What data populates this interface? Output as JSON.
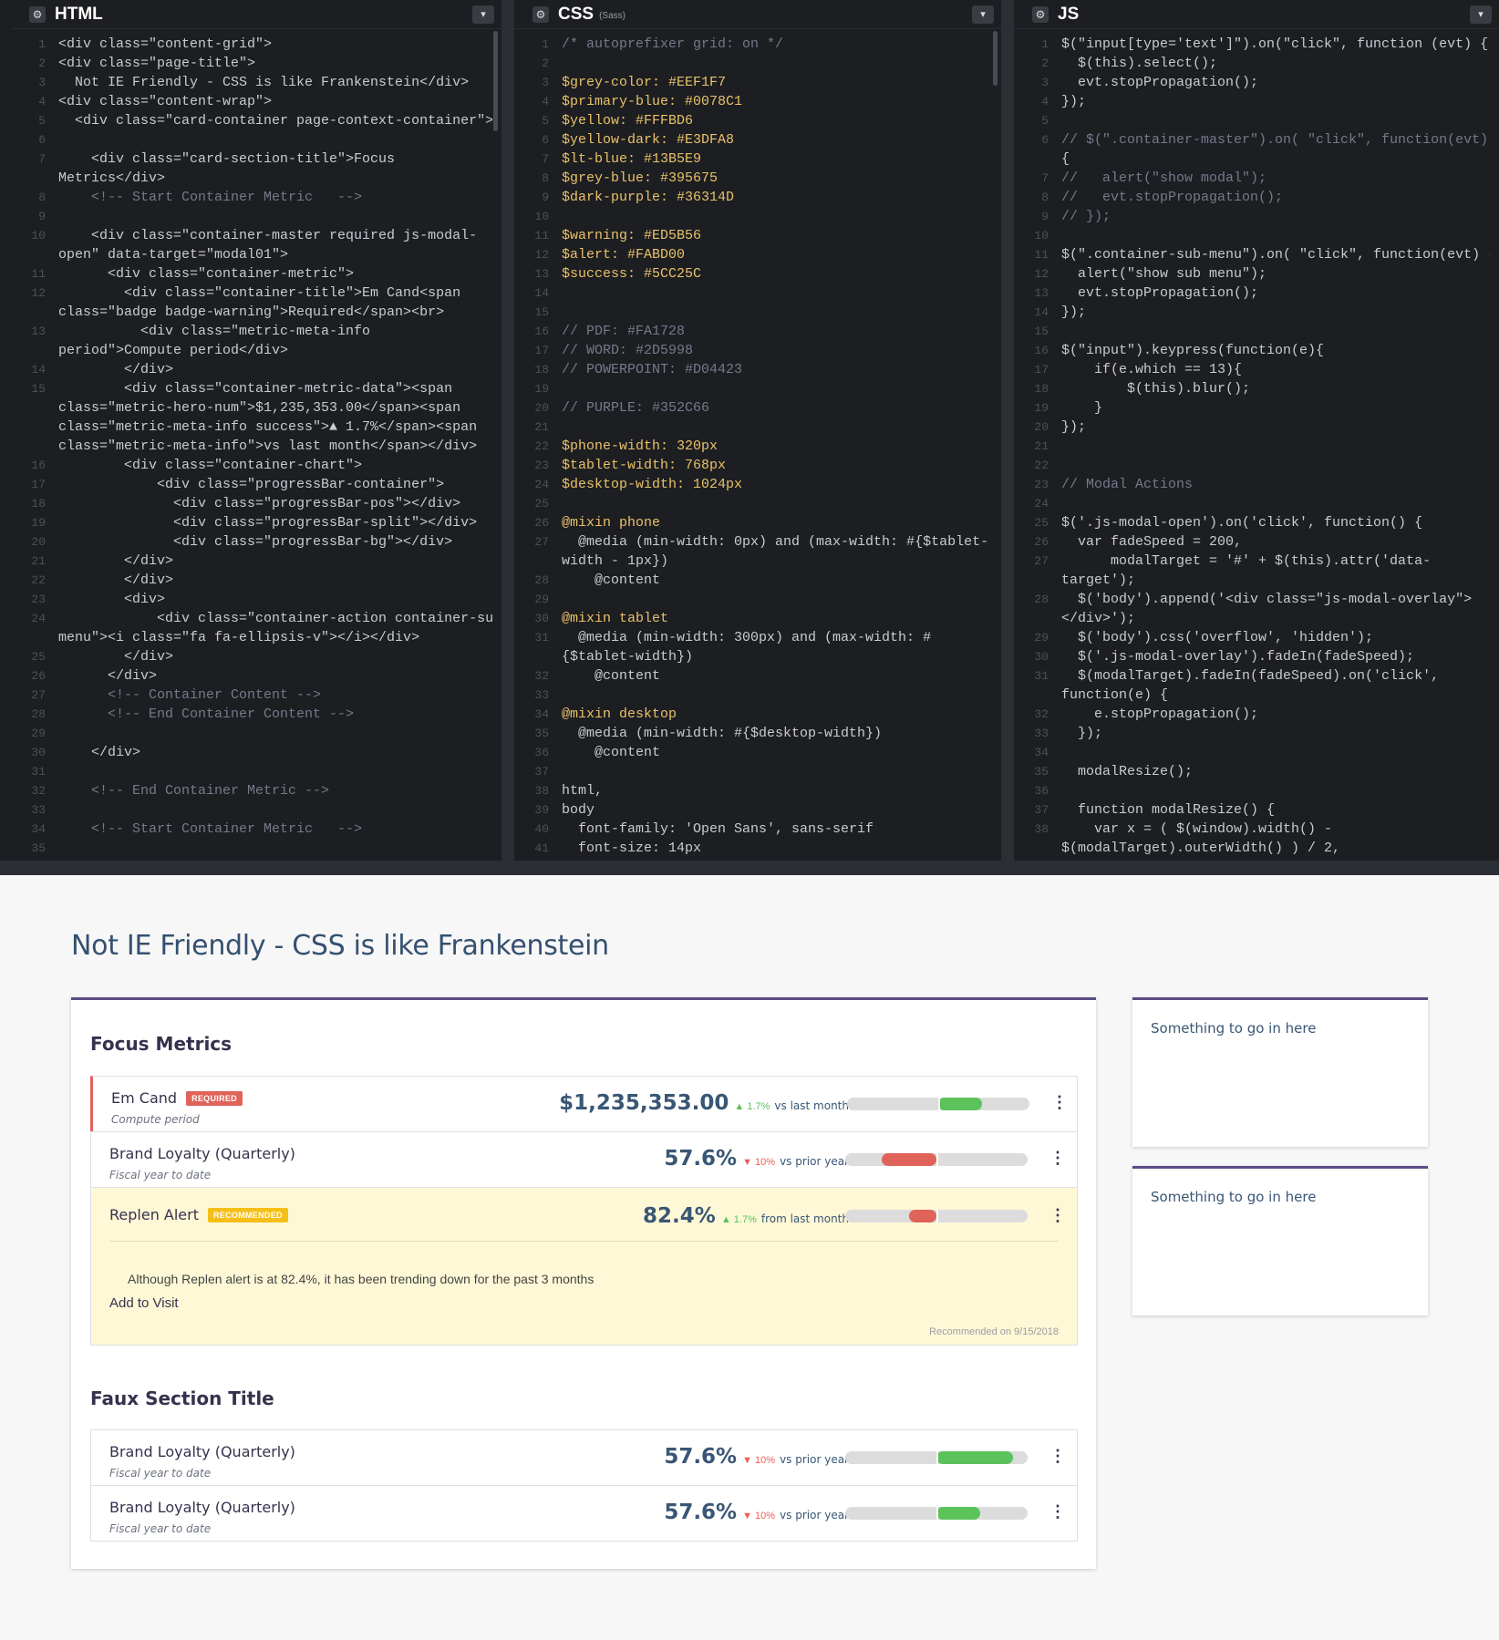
{
  "panes": {
    "html": {
      "title": "HTML",
      "subtitle": ""
    },
    "css": {
      "title": "CSS",
      "subtitle": "(Sass)"
    },
    "js": {
      "title": "JS",
      "subtitle": ""
    }
  },
  "html_code": [
    {
      "n": "1",
      "t": "<div class=\"content-grid\">"
    },
    {
      "n": "2",
      "t": "<div class=\"page-title\">"
    },
    {
      "n": "3",
      "t": "  Not IE Friendly - CSS is like Frankenstein</div>"
    },
    {
      "n": "4",
      "t": "<div class=\"content-wrap\">"
    },
    {
      "n": "5",
      "t": "  <div class=\"card-container page-context-container\">"
    },
    {
      "n": "6",
      "t": ""
    },
    {
      "n": "7",
      "t": "    <div class=\"card-section-title\">Focus"
    },
    {
      "n": "",
      "t": "Metrics</div>"
    },
    {
      "n": "8",
      "t": "    <!-- Start Container Metric   -->"
    },
    {
      "n": "9",
      "t": ""
    },
    {
      "n": "10",
      "t": "    <div class=\"container-master required js-modal-"
    },
    {
      "n": "",
      "t": "open\" data-target=\"modal01\">"
    },
    {
      "n": "11",
      "t": "      <div class=\"container-metric\">"
    },
    {
      "n": "12",
      "t": "        <div class=\"container-title\">Em Cand<span"
    },
    {
      "n": "",
      "t": "class=\"badge badge-warning\">Required</span><br>"
    },
    {
      "n": "13",
      "t": "          <div class=\"metric-meta-info"
    },
    {
      "n": "",
      "t": "period\">Compute period</div>"
    },
    {
      "n": "14",
      "t": "        </div>"
    },
    {
      "n": "15",
      "t": "        <div class=\"container-metric-data\"><span"
    },
    {
      "n": "",
      "t": "class=\"metric-hero-num\">$1,235,353.00</span><span"
    },
    {
      "n": "",
      "t": "class=\"metric-meta-info success\">▲ 1.7%</span><span"
    },
    {
      "n": "",
      "t": "class=\"metric-meta-info\">vs last month</span></div>"
    },
    {
      "n": "16",
      "t": "        <div class=\"container-chart\">"
    },
    {
      "n": "17",
      "t": "            <div class=\"progressBar-container\">"
    },
    {
      "n": "18",
      "t": "              <div class=\"progressBar-pos\"></div>"
    },
    {
      "n": "19",
      "t": "              <div class=\"progressBar-split\"></div>"
    },
    {
      "n": "20",
      "t": "              <div class=\"progressBar-bg\"></div>"
    },
    {
      "n": "21",
      "t": "        </div>"
    },
    {
      "n": "22",
      "t": "        </div>"
    },
    {
      "n": "23",
      "t": "        <div>"
    },
    {
      "n": "24",
      "t": "            <div class=\"container-action container-sub-"
    },
    {
      "n": "",
      "t": "menu\"><i class=\"fa fa-ellipsis-v\"></i></div>"
    },
    {
      "n": "25",
      "t": "        </div>"
    },
    {
      "n": "26",
      "t": "      </div>"
    },
    {
      "n": "27",
      "t": "      <!-- Container Content -->"
    },
    {
      "n": "28",
      "t": "      <!-- End Container Content -->"
    },
    {
      "n": "29",
      "t": ""
    },
    {
      "n": "30",
      "t": "    </div>"
    },
    {
      "n": "31",
      "t": ""
    },
    {
      "n": "32",
      "t": "    <!-- End Container Metric -->"
    },
    {
      "n": "33",
      "t": ""
    },
    {
      "n": "34",
      "t": "    <!-- Start Container Metric   -->"
    },
    {
      "n": "35",
      "t": ""
    }
  ],
  "css_code": [
    {
      "n": "1",
      "t": "/* autoprefixer grid: on */"
    },
    {
      "n": "2",
      "t": ""
    },
    {
      "n": "3",
      "t": "$grey-color: #EEF1F7"
    },
    {
      "n": "4",
      "t": "$primary-blue: #0078C1"
    },
    {
      "n": "5",
      "t": "$yellow: #FFFBD6"
    },
    {
      "n": "6",
      "t": "$yellow-dark: #E3DFA8"
    },
    {
      "n": "7",
      "t": "$lt-blue: #13B5E9"
    },
    {
      "n": "8",
      "t": "$grey-blue: #395675"
    },
    {
      "n": "9",
      "t": "$dark-purple: #36314D"
    },
    {
      "n": "10",
      "t": ""
    },
    {
      "n": "11",
      "t": "$warning: #ED5B56"
    },
    {
      "n": "12",
      "t": "$alert: #FABD00"
    },
    {
      "n": "13",
      "t": "$success: #5CC25C"
    },
    {
      "n": "14",
      "t": ""
    },
    {
      "n": "15",
      "t": ""
    },
    {
      "n": "16",
      "t": "// PDF: #FA1728"
    },
    {
      "n": "17",
      "t": "// WORD: #2D5998"
    },
    {
      "n": "18",
      "t": "// POWERPOINT: #D04423"
    },
    {
      "n": "19",
      "t": ""
    },
    {
      "n": "20",
      "t": "// PURPLE: #352C66"
    },
    {
      "n": "21",
      "t": ""
    },
    {
      "n": "22",
      "t": "$phone-width: 320px"
    },
    {
      "n": "23",
      "t": "$tablet-width: 768px"
    },
    {
      "n": "24",
      "t": "$desktop-width: 1024px"
    },
    {
      "n": "25",
      "t": ""
    },
    {
      "n": "26",
      "t": "@mixin phone"
    },
    {
      "n": "27",
      "t": "  @media (min-width: 0px) and (max-width: #{$tablet-"
    },
    {
      "n": "",
      "t": "width - 1px})"
    },
    {
      "n": "28",
      "t": "    @content"
    },
    {
      "n": "29",
      "t": ""
    },
    {
      "n": "30",
      "t": "@mixin tablet"
    },
    {
      "n": "31",
      "t": "  @media (min-width: 300px) and (max-width: #"
    },
    {
      "n": "",
      "t": "{$tablet-width})"
    },
    {
      "n": "32",
      "t": "    @content"
    },
    {
      "n": "33",
      "t": ""
    },
    {
      "n": "34",
      "t": "@mixin desktop"
    },
    {
      "n": "35",
      "t": "  @media (min-width: #{$desktop-width})"
    },
    {
      "n": "36",
      "t": "    @content"
    },
    {
      "n": "37",
      "t": ""
    },
    {
      "n": "38",
      "t": "html,"
    },
    {
      "n": "39",
      "t": "body"
    },
    {
      "n": "40",
      "t": "  font-family: 'Open Sans', sans-serif"
    },
    {
      "n": "41",
      "t": "  font-size: 14px"
    }
  ],
  "js_code": [
    {
      "n": "1",
      "t": "$(\"input[type='text']\").on(\"click\", function (evt) {"
    },
    {
      "n": "2",
      "t": "  $(this).select();"
    },
    {
      "n": "3",
      "t": "  evt.stopPropagation();"
    },
    {
      "n": "4",
      "t": "});"
    },
    {
      "n": "5",
      "t": ""
    },
    {
      "n": "6",
      "t": "// $(\".container-master\").on( \"click\", function(evt)"
    },
    {
      "n": "",
      "t": "{"
    },
    {
      "n": "7",
      "t": "//   alert(\"show modal\");"
    },
    {
      "n": "8",
      "t": "//   evt.stopPropagation();"
    },
    {
      "n": "9",
      "t": "// });"
    },
    {
      "n": "10",
      "t": ""
    },
    {
      "n": "11",
      "t": "$(\".container-sub-menu\").on( \"click\", function(evt) {"
    },
    {
      "n": "12",
      "t": "  alert(\"show sub menu\");"
    },
    {
      "n": "13",
      "t": "  evt.stopPropagation();"
    },
    {
      "n": "14",
      "t": "});"
    },
    {
      "n": "15",
      "t": ""
    },
    {
      "n": "16",
      "t": "$(\"input\").keypress(function(e){"
    },
    {
      "n": "17",
      "t": "    if(e.which == 13){"
    },
    {
      "n": "18",
      "t": "        $(this).blur();"
    },
    {
      "n": "19",
      "t": "    }"
    },
    {
      "n": "20",
      "t": "});"
    },
    {
      "n": "21",
      "t": ""
    },
    {
      "n": "22",
      "t": ""
    },
    {
      "n": "23",
      "t": "// Modal Actions"
    },
    {
      "n": "24",
      "t": ""
    },
    {
      "n": "25",
      "t": "$('.js-modal-open').on('click', function() {"
    },
    {
      "n": "26",
      "t": "  var fadeSpeed = 200,"
    },
    {
      "n": "27",
      "t": "      modalTarget = '#' + $(this).attr('data-"
    },
    {
      "n": "",
      "t": "target');"
    },
    {
      "n": "28",
      "t": "  $('body').append('<div class=\"js-modal-overlay\">"
    },
    {
      "n": "",
      "t": "</div>');"
    },
    {
      "n": "29",
      "t": "  $('body').css('overflow', 'hidden');"
    },
    {
      "n": "30",
      "t": "  $('.js-modal-overlay').fadeIn(fadeSpeed);"
    },
    {
      "n": "31",
      "t": "  $(modalTarget).fadeIn(fadeSpeed).on('click',"
    },
    {
      "n": "",
      "t": "function(e) {"
    },
    {
      "n": "32",
      "t": "    e.stopPropagation();"
    },
    {
      "n": "33",
      "t": "  });"
    },
    {
      "n": "34",
      "t": ""
    },
    {
      "n": "35",
      "t": "  modalResize();"
    },
    {
      "n": "36",
      "t": ""
    },
    {
      "n": "37",
      "t": "  function modalResize() {"
    },
    {
      "n": "38",
      "t": "    var x = ( $(window).width() -"
    },
    {
      "n": "",
      "t": "$(modalTarget).outerWidth() ) / 2,"
    }
  ],
  "preview": {
    "page_title": "Not IE Friendly - CSS is like Frankenstein",
    "section1_title": "Focus Metrics",
    "section2_title": "Faux Section Title",
    "side_cards": [
      "Something to go in here",
      "Something to go in here"
    ],
    "metrics": [
      {
        "name": "Em Cand",
        "badge": "REQUIRED",
        "sub": "Compute period",
        "value": "$1,235,353.00",
        "delta": "▲ 1.7%",
        "delta_dir": "up",
        "vs": "vs last month",
        "bar_pos": 0.24,
        "bar_dir": "pos"
      },
      {
        "name": "Brand Loyalty (Quarterly)",
        "badge": "",
        "sub": "Fiscal year to date",
        "value": "57.6%",
        "delta": "▼ 10%",
        "delta_dir": "down",
        "vs": "vs prior year",
        "bar_pos": 0.3,
        "bar_dir": "neg"
      },
      {
        "name": "Replen Alert",
        "badge": "RECOMMENDED",
        "sub": "",
        "value": "82.4%",
        "delta": "▲ 1.7%",
        "delta_dir": "up",
        "vs": "from last month",
        "bar_pos": 0.15,
        "bar_dir": "neg"
      }
    ],
    "recommendation": {
      "note": "Although Replen alert is at 82.4%, it has been trending down for the past 3 months",
      "action": "Add to Visit",
      "date": "Recommended on 9/15/2018"
    },
    "faux_metrics": [
      {
        "name": "Brand Loyalty (Quarterly)",
        "sub": "Fiscal year to date",
        "value": "57.6%",
        "delta": "▼ 10%",
        "vs": "vs prior year",
        "bar_pos": 0.42
      },
      {
        "name": "Brand Loyalty (Quarterly)",
        "sub": "Fiscal year to date",
        "value": "57.6%",
        "delta": "▼ 10%",
        "vs": "vs prior year",
        "bar_pos": 0.24
      }
    ],
    "colors": {
      "warning": "#ED5B56",
      "alert": "#FABD00",
      "success": "#5CC25C",
      "grey_blue": "#395675",
      "dark_purple": "#36314D",
      "yellow": "#FFFBD6"
    }
  },
  "icons": {
    "gear": "gear-icon",
    "toggle": "chevron-down-icon",
    "menu": "ellipsis-v-icon"
  }
}
